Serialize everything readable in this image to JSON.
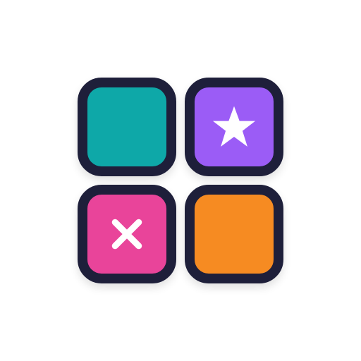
{
  "tiles": [
    {
      "position": "top-left",
      "color": "#0ea8a8",
      "icon": null
    },
    {
      "position": "top-right",
      "color": "#9b5cf6",
      "icon": "star-icon"
    },
    {
      "position": "bottom-left",
      "color": "#e9449a",
      "icon": "close-icon"
    },
    {
      "position": "bottom-right",
      "color": "#f68b22",
      "icon": null
    }
  ],
  "colors": {
    "outline": "#1e1f3a",
    "icon_fill": "#ffffff",
    "background": "#ffffff"
  }
}
